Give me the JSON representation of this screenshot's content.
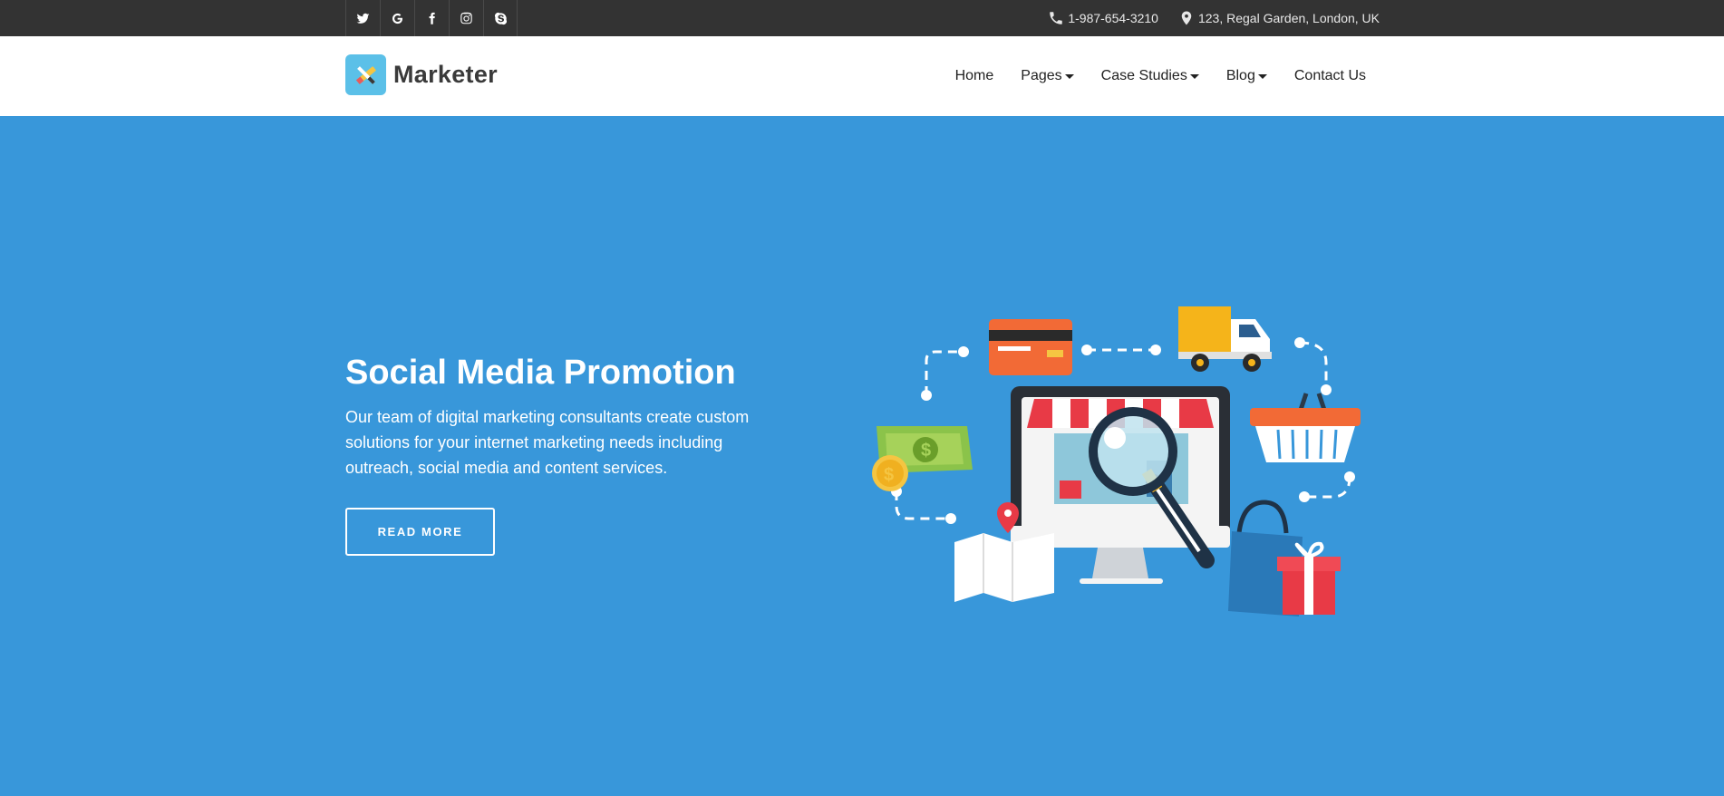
{
  "topbar": {
    "social": [
      {
        "icon": "twitter-icon"
      },
      {
        "icon": "google-icon"
      },
      {
        "icon": "facebook-icon"
      },
      {
        "icon": "instagram-icon"
      },
      {
        "icon": "skype-icon"
      }
    ],
    "phone": "1-987-654-3210",
    "address": "123, Regal Garden, London, UK"
  },
  "header": {
    "logo_text": "Marketer",
    "nav": [
      {
        "label": "Home",
        "has_dropdown": false
      },
      {
        "label": "Pages",
        "has_dropdown": true
      },
      {
        "label": "Case Studies",
        "has_dropdown": true
      },
      {
        "label": "Blog",
        "has_dropdown": true
      },
      {
        "label": "Contact Us",
        "has_dropdown": false
      }
    ]
  },
  "hero": {
    "title": "Social Media Promotion",
    "description": "Our team of digital marketing consultants create custom solutions for your internet marketing needs including outreach, social media and content services.",
    "button_label": "READ MORE"
  },
  "colors": {
    "topbar_bg": "#333333",
    "hero_bg": "#3897da",
    "header_bg": "#ffffff"
  }
}
